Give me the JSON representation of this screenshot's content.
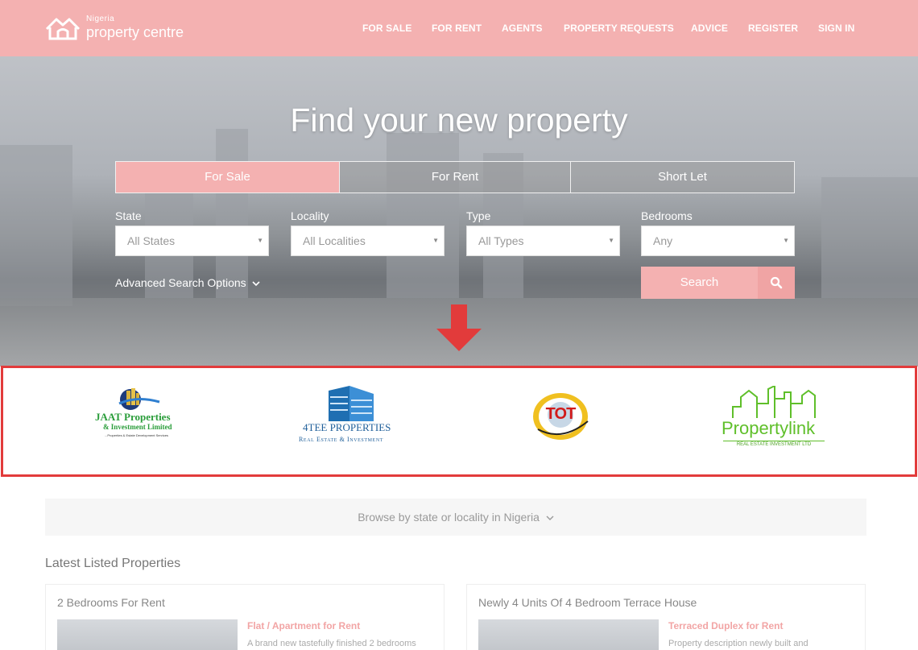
{
  "header": {
    "logo": {
      "small": "Nigeria",
      "big": "property centre",
      "icon": "house-logo-icon"
    },
    "nav": [
      "FOR SALE",
      "FOR RENT",
      "AGENTS",
      "PROPERTY REQUESTS",
      "ADVICE",
      "REGISTER",
      "SIGN IN"
    ]
  },
  "hero": {
    "title": "Find your new property",
    "tabs": [
      "For Sale",
      "For Rent",
      "Short Let"
    ],
    "active_tab": "For Sale",
    "fields": [
      {
        "label": "State",
        "value": "All States"
      },
      {
        "label": "Locality",
        "value": "All Localities"
      },
      {
        "label": "Type",
        "value": "All Types"
      },
      {
        "label": "Bedrooms",
        "value": "Any"
      }
    ],
    "advanced": "Advanced Search Options",
    "search_label": "Search"
  },
  "brands": [
    {
      "line1": "JAAT Properties",
      "line2": "& Investment Limited",
      "line3": "...Properties & Estate Development Services"
    },
    {
      "line1": "4TEE PROPERTIES",
      "line2": "Real Estate & Investment"
    },
    {
      "line1": "TOT"
    },
    {
      "line1": "Propertylink",
      "line2": "REAL ESTATE INVESTMENT LTD"
    }
  ],
  "browse": "Browse by state or locality in Nigeria",
  "latest": {
    "title": "Latest Listed Properties",
    "cards": [
      {
        "title": "2 Bedrooms For Rent",
        "type": "Flat / Apartment for Rent",
        "desc": "A brand new tastefully finished 2 bedrooms"
      },
      {
        "title": "Newly 4 Units Of 4 Bedroom Terrace House",
        "type": "Terraced Duplex for Rent",
        "desc": "Property description newly built and"
      }
    ]
  },
  "colors": {
    "brand_pink": "#f4b1b1",
    "highlight_red": "#e23b3b",
    "jaat_green": "#2a9d3a",
    "tee_blue": "#1f6fb2",
    "plink_green": "#5fbf2a"
  }
}
